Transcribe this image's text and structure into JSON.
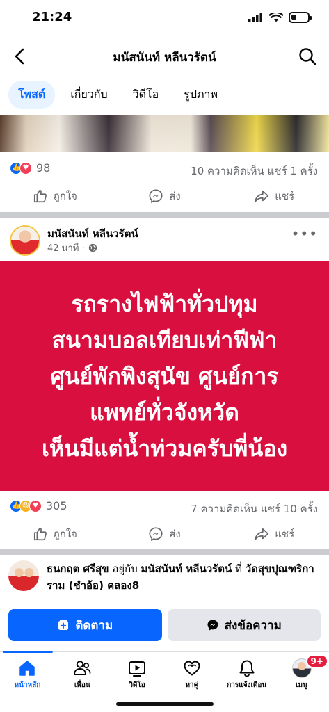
{
  "status_bar": {
    "time": "21:24",
    "battery_level": 0.3
  },
  "header": {
    "title": "มนัสนันท์ หลีนวรัตน์"
  },
  "tabs": [
    {
      "label": "โพสต์",
      "active": true
    },
    {
      "label": "เกี่ยวกับ",
      "active": false
    },
    {
      "label": "วิดีโอ",
      "active": false
    },
    {
      "label": "รูปภาพ",
      "active": false
    }
  ],
  "post1": {
    "reaction_count": "98",
    "stats": "10 ความคิดเห็น  แชร์ 1 ครั้ง",
    "actions": {
      "like": "ถูกใจ",
      "send": "ส่ง",
      "share": "แชร์"
    }
  },
  "post2": {
    "author": "มนัสนันท์ หลีนวรัตน์",
    "time": "42 นาที ·",
    "text_lines": [
      "รถรางไฟฟ้าทั่วปทุม",
      "สนามบอลเทียบเท่าฟีฟ่า",
      "ศูนย์พักพิงสุนัข ศูนย์การ",
      "แพทย์ทั่วจังหวัด",
      "เห็นมีแต่น้ำท่วมครับพี่น้อง"
    ],
    "background_color": "#d80f3f",
    "reaction_count": "305",
    "stats": "7 ความคิดเห็น  แชร์ 10 ครั้ง",
    "actions": {
      "like": "ถูกใจ",
      "send": "ส่ง",
      "share": "แชร์"
    }
  },
  "post3": {
    "author": "ธนกฤต ศรีสุข",
    "with_text": "อยู่กับ",
    "tagged": "มนัสนันท์ หลีนวรัตน์",
    "at_text": "ที่",
    "place": "วัดสุขปุณฑริการาม (ชำอ้อ) คลอง8"
  },
  "cta": {
    "follow": "ติดตาม",
    "message": "ส่งข้อความ"
  },
  "bottom_nav": [
    {
      "label": "หน้าหลัก",
      "icon": "home-icon",
      "active": true
    },
    {
      "label": "เพื่อน",
      "icon": "friends-icon",
      "active": false
    },
    {
      "label": "วิดีโอ",
      "icon": "video-icon",
      "active": false
    },
    {
      "label": "หาคู่",
      "icon": "dating-icon",
      "active": false
    },
    {
      "label": "การแจ้งเตือน",
      "icon": "bell-icon",
      "active": false
    },
    {
      "label": "เมนู",
      "icon": "menu-avatar",
      "active": false,
      "badge": "9+"
    }
  ],
  "colors": {
    "accent": "#0866ff",
    "like": "#0866ff",
    "love": "#f33e58",
    "haha": "#f7b125",
    "badge": "#e41e3f"
  }
}
